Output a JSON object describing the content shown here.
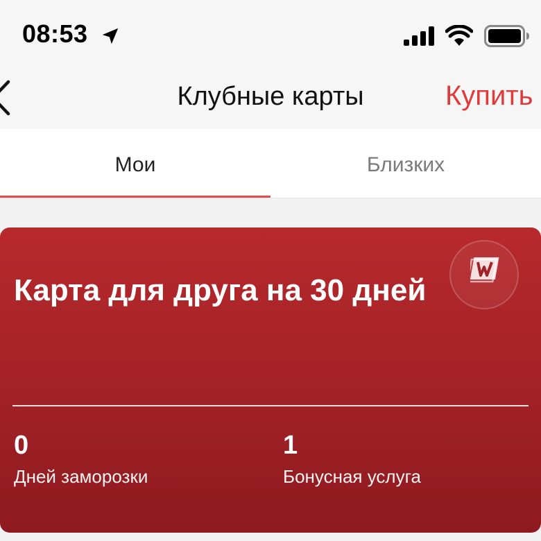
{
  "status_bar": {
    "time": "08:53",
    "icons": [
      "location-arrow-icon",
      "cellular-signal-icon",
      "wifi-icon",
      "battery-icon"
    ]
  },
  "nav": {
    "back_icon": "chevron-left-icon",
    "title": "Клубные карты",
    "action_label": "Купить"
  },
  "tabs": [
    {
      "label": "Мои",
      "active": true
    },
    {
      "label": "Близких",
      "active": false
    }
  ],
  "card": {
    "title": "Карта для друга на 30 дней",
    "logo_letter": "W",
    "stats": [
      {
        "value": "0",
        "label": "Дней заморозки"
      },
      {
        "value": "1",
        "label": "Бонусная услуга"
      }
    ]
  },
  "colors": {
    "accent": "#e03a3a",
    "card_top": "#b7292c",
    "card_bottom": "#8e1a1f"
  }
}
